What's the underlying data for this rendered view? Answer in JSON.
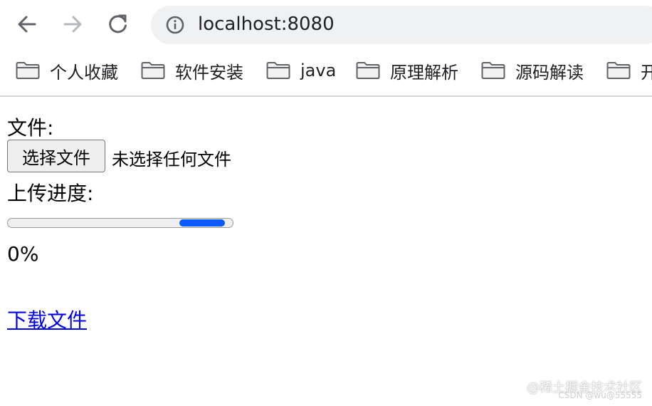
{
  "browser": {
    "url": "localhost:8080",
    "icons": {
      "back": "arrow-left-icon",
      "forward": "arrow-right-icon",
      "reload": "reload-icon",
      "info": "info-icon",
      "folder": "folder-icon"
    },
    "colors": {
      "address_bar_bg": "#f0f1f3",
      "forward_disabled": "#9aa0a6"
    }
  },
  "bookmarks": [
    {
      "label": "个人收藏"
    },
    {
      "label": "软件安装"
    },
    {
      "label": "java"
    },
    {
      "label": "原理解析"
    },
    {
      "label": "源码解读"
    },
    {
      "label": "开"
    }
  ],
  "page": {
    "file_label": "文件:",
    "file_button_label": "选择文件",
    "file_status": "未选择任何文件",
    "progress_label": "上传进度:",
    "progress_percent_text": "0%",
    "download_link_text": "下载文件",
    "progress_color": "#0a5cff",
    "link_color": "#0000ee"
  },
  "watermark": {
    "text": "@稀土掘金技术社区",
    "subtext": "CSDN @wu@55555"
  }
}
